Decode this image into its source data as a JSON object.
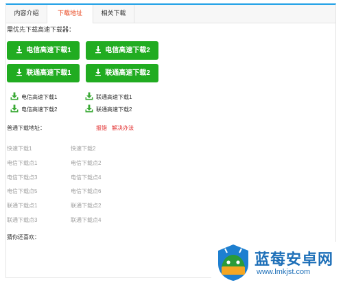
{
  "tabs": [
    "内容介绍",
    "下载地址",
    "相关下载"
  ],
  "active_tab": 1,
  "hint": "需优先下载高速下载器：",
  "green_buttons": [
    "电信高速下载1",
    "电信高速下载2",
    "联通高速下载1",
    "联通高速下载2"
  ],
  "small_links": [
    "电信高速下载1",
    "联通高速下载1",
    "电信高速下载2",
    "联通高速下载2"
  ],
  "normal_title": "普通下载地址：",
  "error_links": [
    "报错",
    "解决办法"
  ],
  "normal_links": [
    "快速下载1",
    "快速下载2",
    "电信下载点1",
    "电信下载点2",
    "电信下载点3",
    "电信下载点4",
    "电信下载点5",
    "电信下载点6",
    "联通下载点1",
    "联通下载点2",
    "联通下载点3",
    "联通下载点4"
  ],
  "guess_title": "猜你还喜欢：",
  "watermark": {
    "name": "蓝莓安卓网",
    "url": "www.lmkjst.com"
  },
  "colors": {
    "accent_blue": "#1e9fe6",
    "green": "#21ac21",
    "red": "#e22d2d",
    "orange_tab": "#e8461e"
  }
}
